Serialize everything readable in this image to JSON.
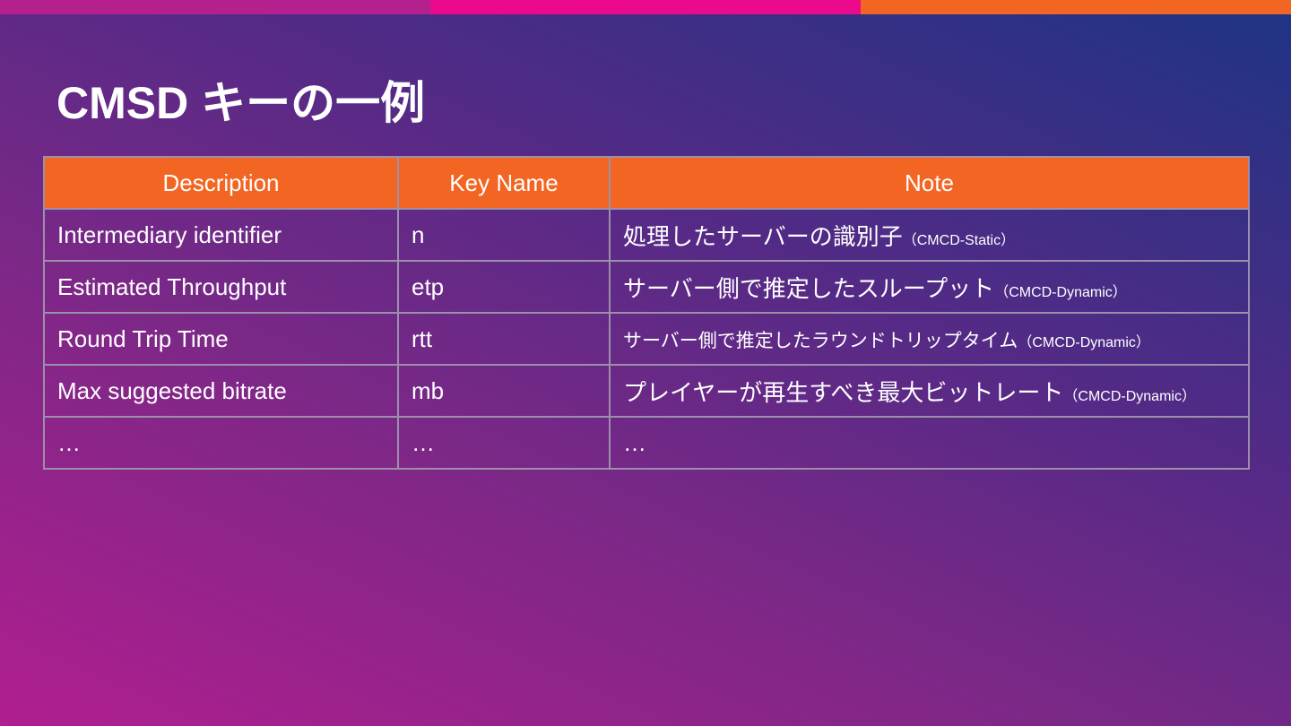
{
  "colors": {
    "accent_magenta": "#b5208f",
    "accent_pink": "#ec0a8c",
    "accent_orange": "#f26522",
    "header_bg": "#f26522",
    "background_start": "#b01e8f",
    "background_end": "#1e3484"
  },
  "top_bar": {
    "segments": [
      "#b5208f",
      "#ec0a8c",
      "#f26522"
    ]
  },
  "slide": {
    "title": "CMSD キーの一例"
  },
  "table": {
    "headers": [
      "Description",
      "Key Name",
      "Note"
    ],
    "rows": [
      {
        "description": "Intermediary identifier",
        "key": "n",
        "note": "処理したサーバーの識別子",
        "note_suffix": "（CMCD-Static）"
      },
      {
        "description": "Estimated Throughput",
        "key": "etp",
        "note": "サーバー側で推定したスループット",
        "note_suffix": "（CMCD-Dynamic）"
      },
      {
        "description": "Round Trip Time",
        "key": "rtt",
        "note": "サーバー側で推定したラウンドトリップタイム",
        "note_suffix": "（CMCD-Dynamic）"
      },
      {
        "description": "Max suggested bitrate",
        "key": "mb",
        "note": "プレイヤーが再生すべき最大ビットレート",
        "note_suffix": "（CMCD-Dynamic）"
      },
      {
        "description": "…",
        "key": "…",
        "note": "…",
        "note_suffix": ""
      }
    ]
  }
}
